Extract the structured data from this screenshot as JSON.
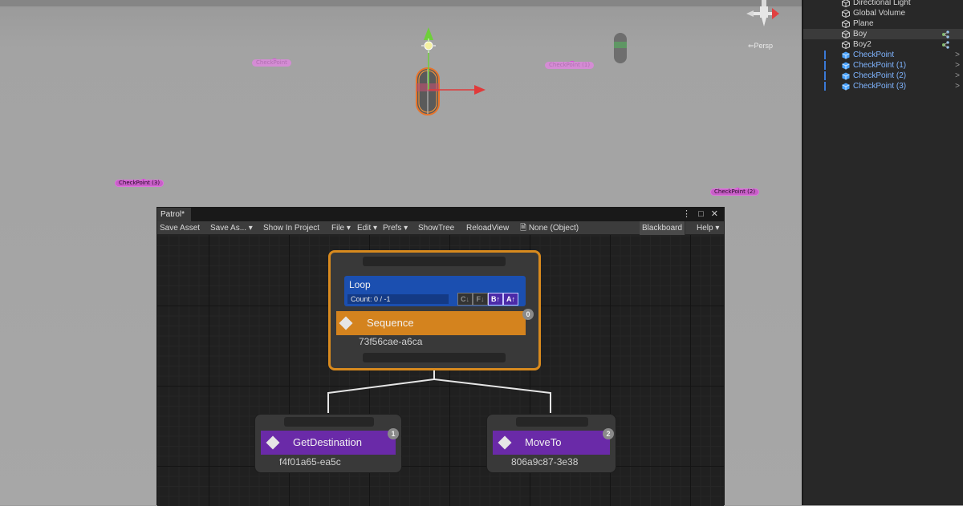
{
  "scene": {
    "persp_label": "⇐Persp",
    "checkpoints": [
      {
        "name": "CheckPoint",
        "faded": true
      },
      {
        "name": "CheckPoint (1)",
        "faded": true
      },
      {
        "name": "CheckPoint (3)",
        "faded": false
      },
      {
        "name": "CheckPoint (2)",
        "faded": false
      }
    ]
  },
  "hierarchy": {
    "items": [
      {
        "label": "Directional Light",
        "kind": "object"
      },
      {
        "label": "Global Volume",
        "kind": "object"
      },
      {
        "label": "Plane",
        "kind": "object"
      },
      {
        "label": "Boy",
        "kind": "object",
        "selected": true,
        "prefab": true
      },
      {
        "label": "Boy2",
        "kind": "object",
        "prefab": true
      },
      {
        "label": "CheckPoint",
        "kind": "prefab"
      },
      {
        "label": "CheckPoint (1)",
        "kind": "prefab"
      },
      {
        "label": "CheckPoint (2)",
        "kind": "prefab"
      },
      {
        "label": "CheckPoint (3)",
        "kind": "prefab"
      }
    ]
  },
  "window": {
    "tab_label": "Patrol*",
    "controls": "⋮ □ ✕",
    "toolbar": {
      "save_asset": "Save Asset",
      "save_as": "Save As... ▾",
      "show_in_project": "Show In Project",
      "file": "File ▾",
      "edit": "Edit ▾",
      "prefs": "Prefs ▾",
      "show_tree": "ShowTree",
      "reload_view": "ReloadView",
      "object_field": "🗎 None (Object)",
      "blackboard": "Blackboard",
      "help": "Help ▾"
    }
  },
  "graph": {
    "root": {
      "decorator_title": "Loop",
      "decorator_count": "Count: 0 / -1",
      "flags": [
        {
          "label": "C↓",
          "on": false
        },
        {
          "label": "F↓",
          "on": false
        },
        {
          "label": "B↑",
          "on": true
        },
        {
          "label": "A↑",
          "on": true
        }
      ],
      "title": "Sequence",
      "guid": "73f56cae-a6ca",
      "index": "0",
      "color": "#d4831e"
    },
    "children": [
      {
        "title": "GetDestination",
        "guid": "f4f01a65-ea5c",
        "index": "1",
        "color": "#6a2aa8"
      },
      {
        "title": "MoveTo",
        "guid": "806a9c87-3e38",
        "index": "2",
        "color": "#6a2aa8"
      }
    ]
  }
}
